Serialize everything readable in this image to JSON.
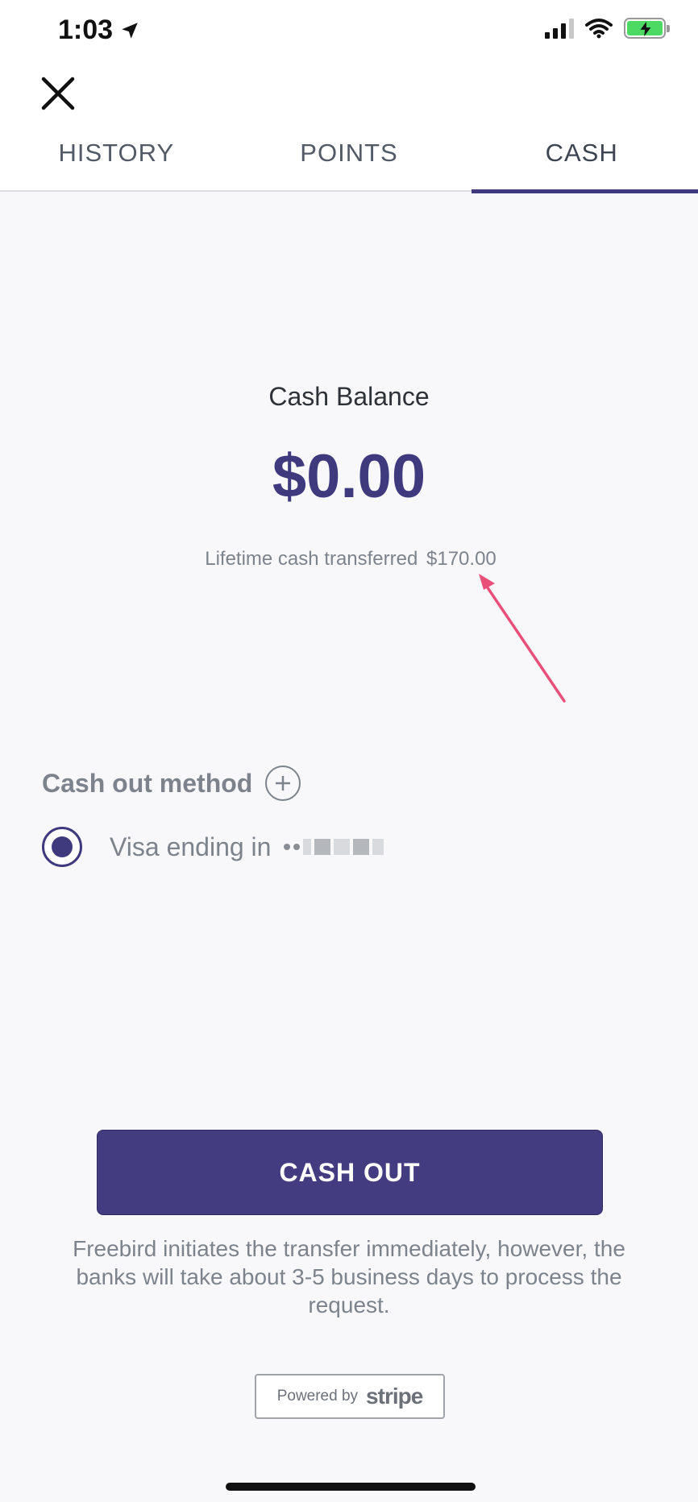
{
  "status_bar": {
    "time": "1:03",
    "icons": [
      "location-arrow-icon",
      "signal-icon",
      "wifi-icon",
      "battery-charging-icon"
    ]
  },
  "header": {
    "close_icon": "close-icon",
    "tabs": [
      {
        "label": "HISTORY",
        "active": false
      },
      {
        "label": "POINTS",
        "active": false
      },
      {
        "label": "CASH",
        "active": true
      }
    ]
  },
  "balance": {
    "label": "Cash Balance",
    "amount": "$0.00",
    "lifetime_label": "Lifetime cash transferred",
    "lifetime_amount": "$170.00"
  },
  "cash_out_method": {
    "title": "Cash out method",
    "add_icon": "plus-circle-icon",
    "method_label": "Visa ending in",
    "selected": true
  },
  "actions": {
    "cash_out_label": "CASH OUT",
    "disclaimer": "Freebird initiates the transfer immediately, however, the banks will take about 3-5 business days to process the request."
  },
  "footer": {
    "powered_by": "Powered by",
    "brand": "stripe"
  },
  "colors": {
    "accent": "#3f3a7d",
    "button": "#433c80",
    "muted_text": "#7d838c",
    "annotation": "#e8507a"
  }
}
